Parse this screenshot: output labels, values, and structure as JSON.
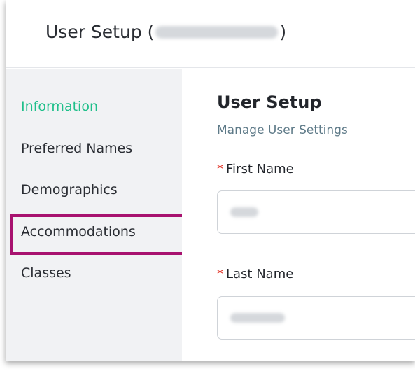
{
  "header": {
    "title_prefix": "User Setup (",
    "title_suffix": ")"
  },
  "sidebar": {
    "items": [
      {
        "label": "Information",
        "active": true
      },
      {
        "label": "Preferred Names",
        "active": false
      },
      {
        "label": "Demographics",
        "active": false
      },
      {
        "label": "Accommodations",
        "active": false
      },
      {
        "label": "Classes",
        "active": false
      }
    ]
  },
  "main": {
    "title": "User Setup",
    "subtitle": "Manage User Settings",
    "fields": [
      {
        "label": "First Name",
        "required_mark": "*"
      },
      {
        "label": "Last Name",
        "required_mark": "*"
      }
    ]
  },
  "colors": {
    "active_nav": "#1fbf8a",
    "highlight_border": "#a8126f",
    "required": "#e0281b",
    "sidebar_bg": "#f1f2f4"
  }
}
